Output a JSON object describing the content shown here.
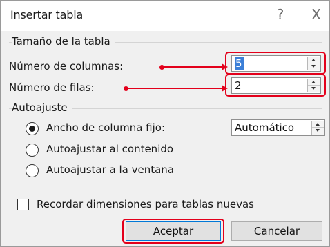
{
  "dialog": {
    "title": "Insertar tabla",
    "help_label": "?",
    "close_label": "X"
  },
  "table_size": {
    "group_label": "Tamaño de la tabla",
    "columns_label": "Número de columnas:",
    "columns_value": "5",
    "rows_label": "Número de filas:",
    "rows_value": "2"
  },
  "autofit": {
    "group_label": "Autoajuste",
    "options": [
      {
        "label": "Ancho de columna fijo:",
        "checked": true
      },
      {
        "label": "Autoajustar al contenido",
        "checked": false
      },
      {
        "label": "Autoajustar a la ventana",
        "checked": false
      }
    ],
    "fixed_width_value": "Automático"
  },
  "remember": {
    "label": "Recordar dimensiones para tablas nuevas",
    "checked": false
  },
  "buttons": {
    "ok_label": "Aceptar",
    "cancel_label": "Cancelar"
  },
  "colors": {
    "annotation": "#e3001b",
    "selection": "#3c7fd7",
    "dialog_bg": "#f0f0f0"
  }
}
